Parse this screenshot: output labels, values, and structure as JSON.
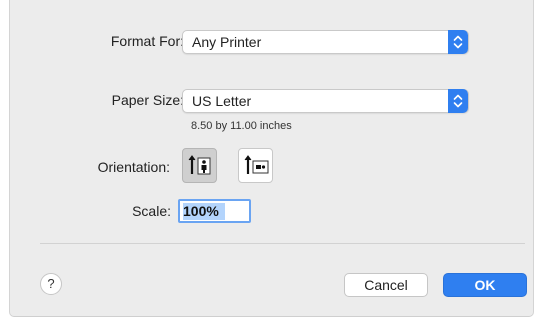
{
  "dialog": {
    "format_for": {
      "label": "Format For:",
      "value": "Any Printer"
    },
    "paper_size": {
      "label": "Paper Size:",
      "value": "US Letter",
      "dimensions": "8.50 by 11.00 inches"
    },
    "orientation": {
      "label": "Orientation:",
      "options": [
        "portrait",
        "landscape"
      ],
      "selected": "portrait"
    },
    "scale": {
      "label": "Scale:",
      "value": "100%"
    },
    "buttons": {
      "help": "?",
      "cancel": "Cancel",
      "ok": "OK"
    }
  },
  "colors": {
    "accent": "#2f7ff0",
    "dialog_bg": "#ececec"
  },
  "icons": {
    "popup_arrows": "up-down-chevrons-icon",
    "portrait": "portrait-orientation-icon",
    "landscape": "landscape-orientation-icon"
  }
}
